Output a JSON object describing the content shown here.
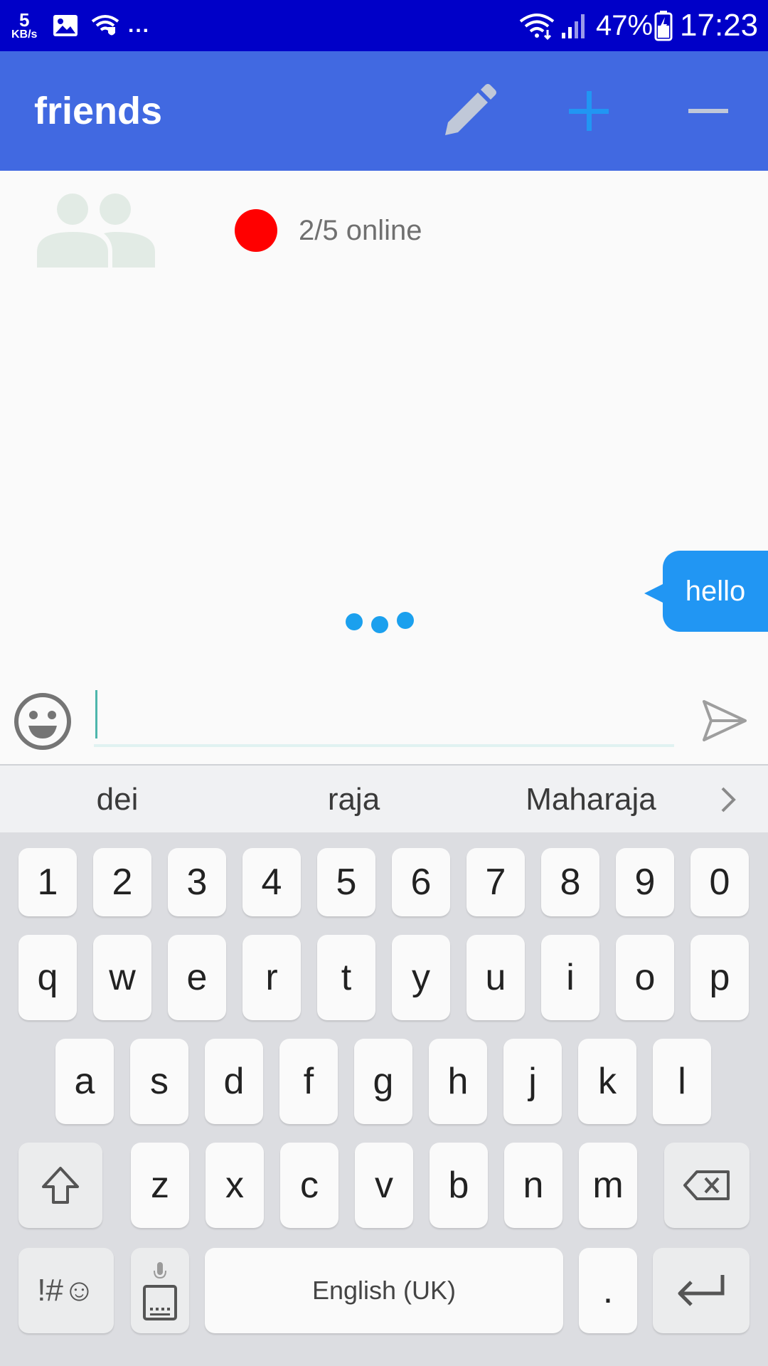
{
  "status_bar": {
    "speed_value": "5",
    "speed_unit": "KB/s",
    "overflow": "...",
    "battery_percent": "47%",
    "time": "17:23",
    "icons": [
      "image-icon",
      "wifi-shield-icon",
      "wifi-icon",
      "signal-icon",
      "battery-charging-icon"
    ]
  },
  "app_bar": {
    "title": "friends",
    "actions": [
      "pencil-icon",
      "plus-icon",
      "minus-icon"
    ],
    "colors": {
      "background": "#4169e1",
      "edit_icon": "#c0c8d8",
      "add_icon": "#2196f3",
      "remove_icon": "#c0c8d8"
    }
  },
  "group": {
    "online_status": "2/5 online",
    "status_color": "#ff0000"
  },
  "chat": {
    "messages": [
      {
        "text": "hello",
        "sender": "me"
      }
    ],
    "bubble_color": "#2196f3",
    "typing_indicator": true
  },
  "composer": {
    "value": "",
    "placeholder": ""
  },
  "keyboard": {
    "suggestions": [
      "dei",
      "raja",
      "Maharaja"
    ],
    "rows": {
      "numbers": [
        "1",
        "2",
        "3",
        "4",
        "5",
        "6",
        "7",
        "8",
        "9",
        "0"
      ],
      "row1": [
        "q",
        "w",
        "e",
        "r",
        "t",
        "y",
        "u",
        "i",
        "o",
        "p"
      ],
      "row2": [
        "a",
        "s",
        "d",
        "f",
        "g",
        "h",
        "j",
        "k",
        "l"
      ],
      "row3": [
        "z",
        "x",
        "c",
        "v",
        "b",
        "n",
        "m"
      ]
    },
    "symbols_key": "!#☺",
    "space_key": "English (UK)",
    "period_key": "."
  }
}
